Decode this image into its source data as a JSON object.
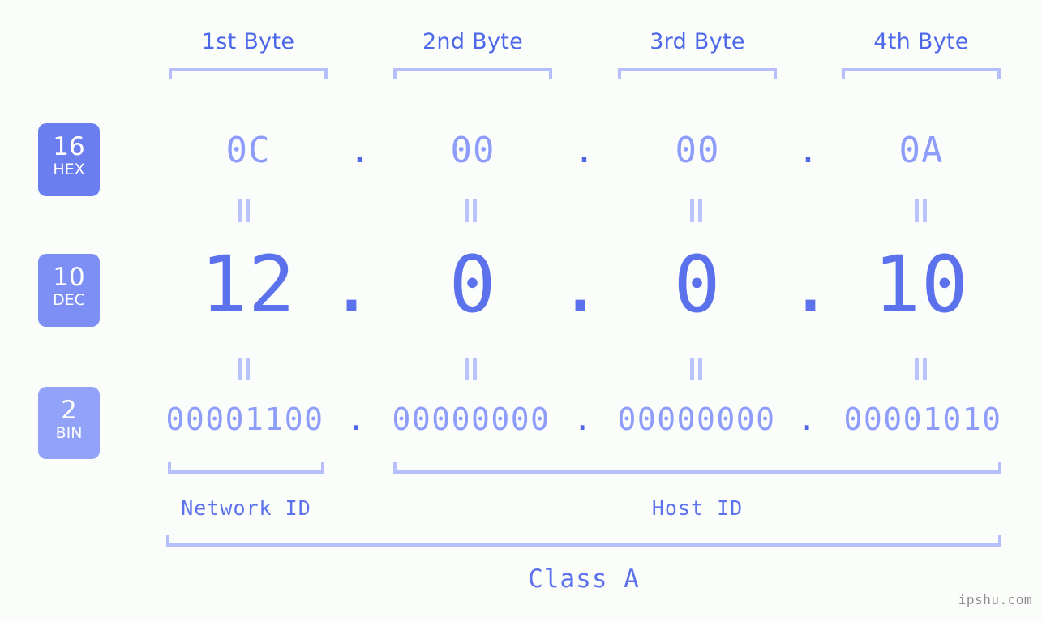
{
  "background_color": "#fbfdfa",
  "accent_colors": {
    "header_blue": "#4c67e8",
    "bracket_blue": "#b4bffc",
    "light_value": "#8e9dfa",
    "strong_value": "#5c72ec",
    "badge_hex": "#6b7ef0",
    "badge_dec": "#7d8ef4",
    "badge_bin": "#92a2f8",
    "watermark_gray": "#8d8d8d"
  },
  "byte_headers": [
    {
      "label": "1st Byte"
    },
    {
      "label": "2nd Byte"
    },
    {
      "label": "3rd Byte"
    },
    {
      "label": "4th Byte"
    }
  ],
  "bases": [
    {
      "number": "16",
      "name": "HEX"
    },
    {
      "number": "10",
      "name": "DEC"
    },
    {
      "number": "2",
      "name": "BIN"
    }
  ],
  "separator": ".",
  "equals_glyph": "=",
  "rows": {
    "hex": {
      "values": [
        "0C",
        "00",
        "00",
        "0A"
      ]
    },
    "dec": {
      "values": [
        "12",
        "0",
        "0",
        "10"
      ]
    },
    "bin": {
      "values": [
        "00001100",
        "00000000",
        "00000000",
        "00001010"
      ]
    }
  },
  "sections": [
    {
      "label": "Network ID"
    },
    {
      "label": "Host ID"
    }
  ],
  "class": {
    "label": "Class A"
  },
  "watermark": {
    "text": "ipshu.com"
  }
}
